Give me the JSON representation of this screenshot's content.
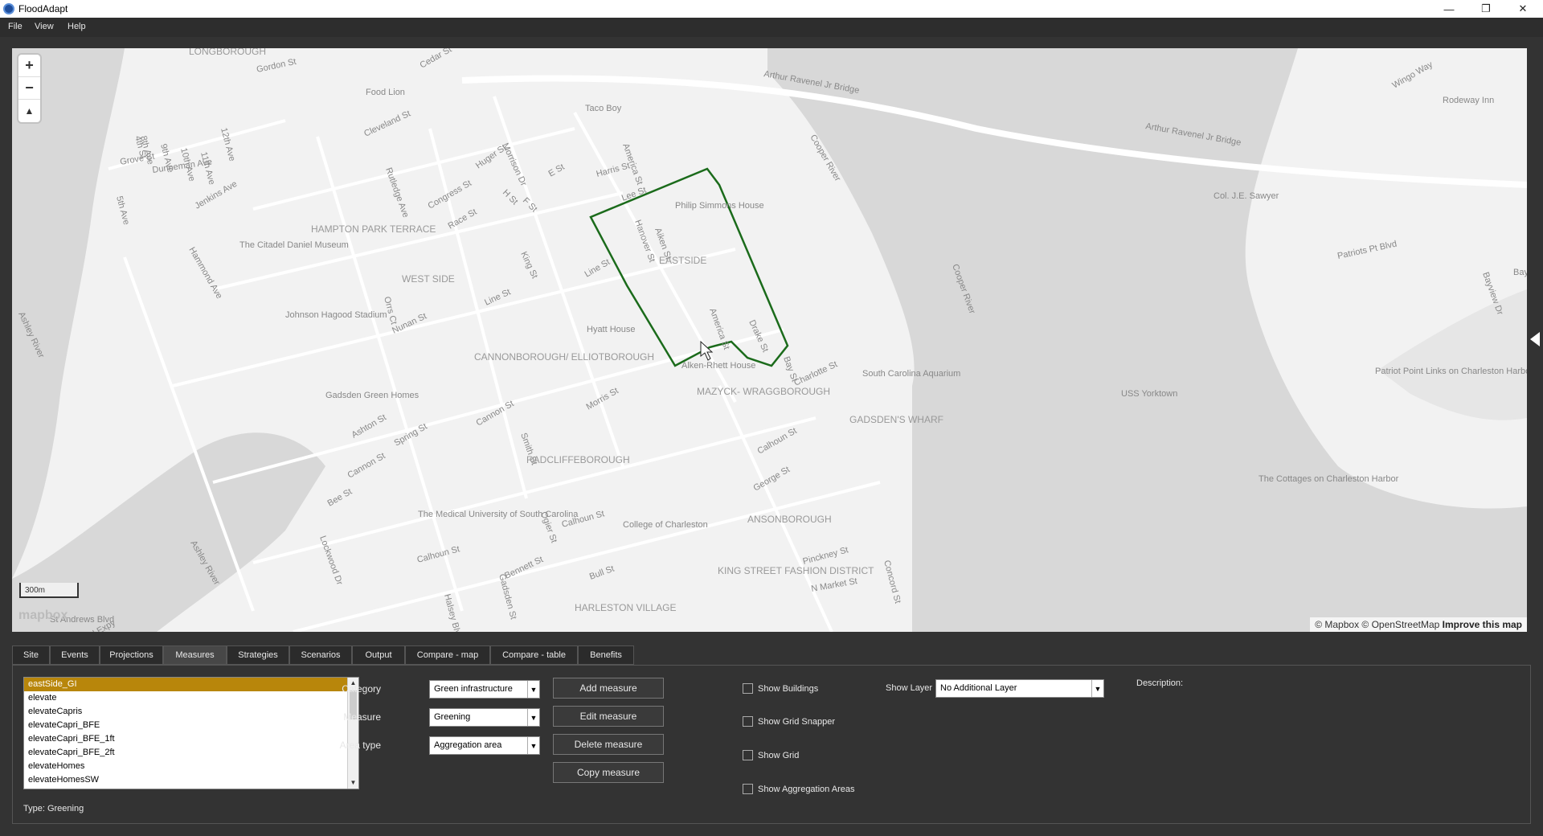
{
  "window": {
    "title": "FloodAdapt",
    "minimize": "—",
    "maximize": "❐",
    "close": "✕"
  },
  "menu": [
    "File",
    "View",
    "Help"
  ],
  "map": {
    "zoom_in": "+",
    "zoom_out": "−",
    "north": "▲",
    "scale": "300m",
    "logo": "mapbox",
    "attribution_text": "© Mapbox © OpenStreetMap",
    "attribution_link": "Improve this map",
    "labels": [
      "LONGBOROUGH",
      "Gordon St",
      "Cedar St",
      "Morrison Dr",
      "Arthur Ravenel Jr Bridge",
      "Arthur Ravenel Jr Bridge",
      "Wingo Way",
      "Rodeway Inn",
      "Food Lion",
      "Taco Boy",
      "Cooper River",
      "Cleveland St",
      "Huger St",
      "America St",
      "Harris St",
      "E St",
      "Grove St",
      "Dunneman Ave",
      "5th Ave",
      "Jenkins Ave",
      "Rutledge Ave",
      "Congress St",
      "Race St",
      "H St",
      "F St",
      "Lee St",
      "Philip Simmons House",
      "Hanover St",
      "Aiken St",
      "HAMPTON PARK TERRACE",
      "The Citadel Daniel Museum",
      "Hammond Ave",
      "King St",
      "EASTSIDE",
      "Line St",
      "WEST SIDE",
      "Johnson Hagood Stadium",
      "Ashley River",
      "Orrs Ct",
      "Line St",
      "America St",
      "Drake St",
      "Hyatt House",
      "Nunan St",
      "CANNONBOROUGH/ ELLIOTBOROUGH",
      "Alken-Rhett House",
      "Bay St",
      "Charlotte St",
      "South Carolina Aquarium",
      "Gadsden Green Homes",
      "Ashton St",
      "Spring St",
      "Cannon St",
      "Smith St",
      "Morris St",
      "MAZYCK- WRAGGBOROUGH",
      "GADSDEN'S WHARF",
      "Calhoun St",
      "USS Yorktown",
      "Cannon St",
      "RADCLIFFEBOROUGH",
      "George St",
      "Bee St",
      "The Medical University of South Carolina",
      "Calhoun St",
      "Ogier St",
      "College of Charleston",
      "ANSONBOROUGH",
      "Lockwood Dr",
      "Calhoun St",
      "Bennett St",
      "Bull St",
      "KING STREET FASHION DISTRICT",
      "Pinckney St",
      "N Market St",
      "Concord St",
      "HARLESTON VILLAGE",
      "Halsey Blvd",
      "Gadsden St",
      "St Andrews Blvd",
      "Island Expy",
      "Patriots Pt Blvd",
      "Col. J.E. Sawyer",
      "Patriot Point Links on Charleston Harbor",
      "The Cottages on Charleston Harbor",
      "Bayview Dr",
      "Bay",
      "Cooper River",
      "Ashley River",
      "8th Ave",
      "9th Ave",
      "10th Ave",
      "11th Ave",
      "12th Ave",
      "4th St"
    ]
  },
  "tabs": [
    "Site",
    "Events",
    "Projections",
    "Measures",
    "Strategies",
    "Scenarios",
    "Output",
    "Compare - map",
    "Compare - table",
    "Benefits"
  ],
  "active_tab": "Measures",
  "measures": {
    "list": [
      "eastSide_GI",
      "elevate",
      "elevateCapris",
      "elevateCapri_BFE",
      "elevateCapri_BFE_1ft",
      "elevateCapri_BFE_2ft",
      "elevateHomes",
      "elevateHomesSW"
    ],
    "selected": "eastSide_GI",
    "type_label": "Type: Greening",
    "category_label": "Category",
    "category_value": "Green infrastructure",
    "measure_label": "Measure",
    "measure_value": "Greening",
    "area_type_label": "Area type",
    "area_type_value": "Aggregation area",
    "add_button": "Add measure",
    "edit_button": "Edit measure",
    "delete_button": "Delete measure",
    "copy_button": "Copy measure",
    "checkboxes": [
      "Show Buildings",
      "Show Grid Snapper",
      "Show Grid",
      "Show Aggregation Areas"
    ],
    "show_layer_label": "Show Layer",
    "show_layer_value": "No Additional Layer",
    "description_label": "Description:"
  },
  "colors": {
    "polygon": "#1b6b1b",
    "selected": "#b8860b",
    "panel": "#333333"
  }
}
